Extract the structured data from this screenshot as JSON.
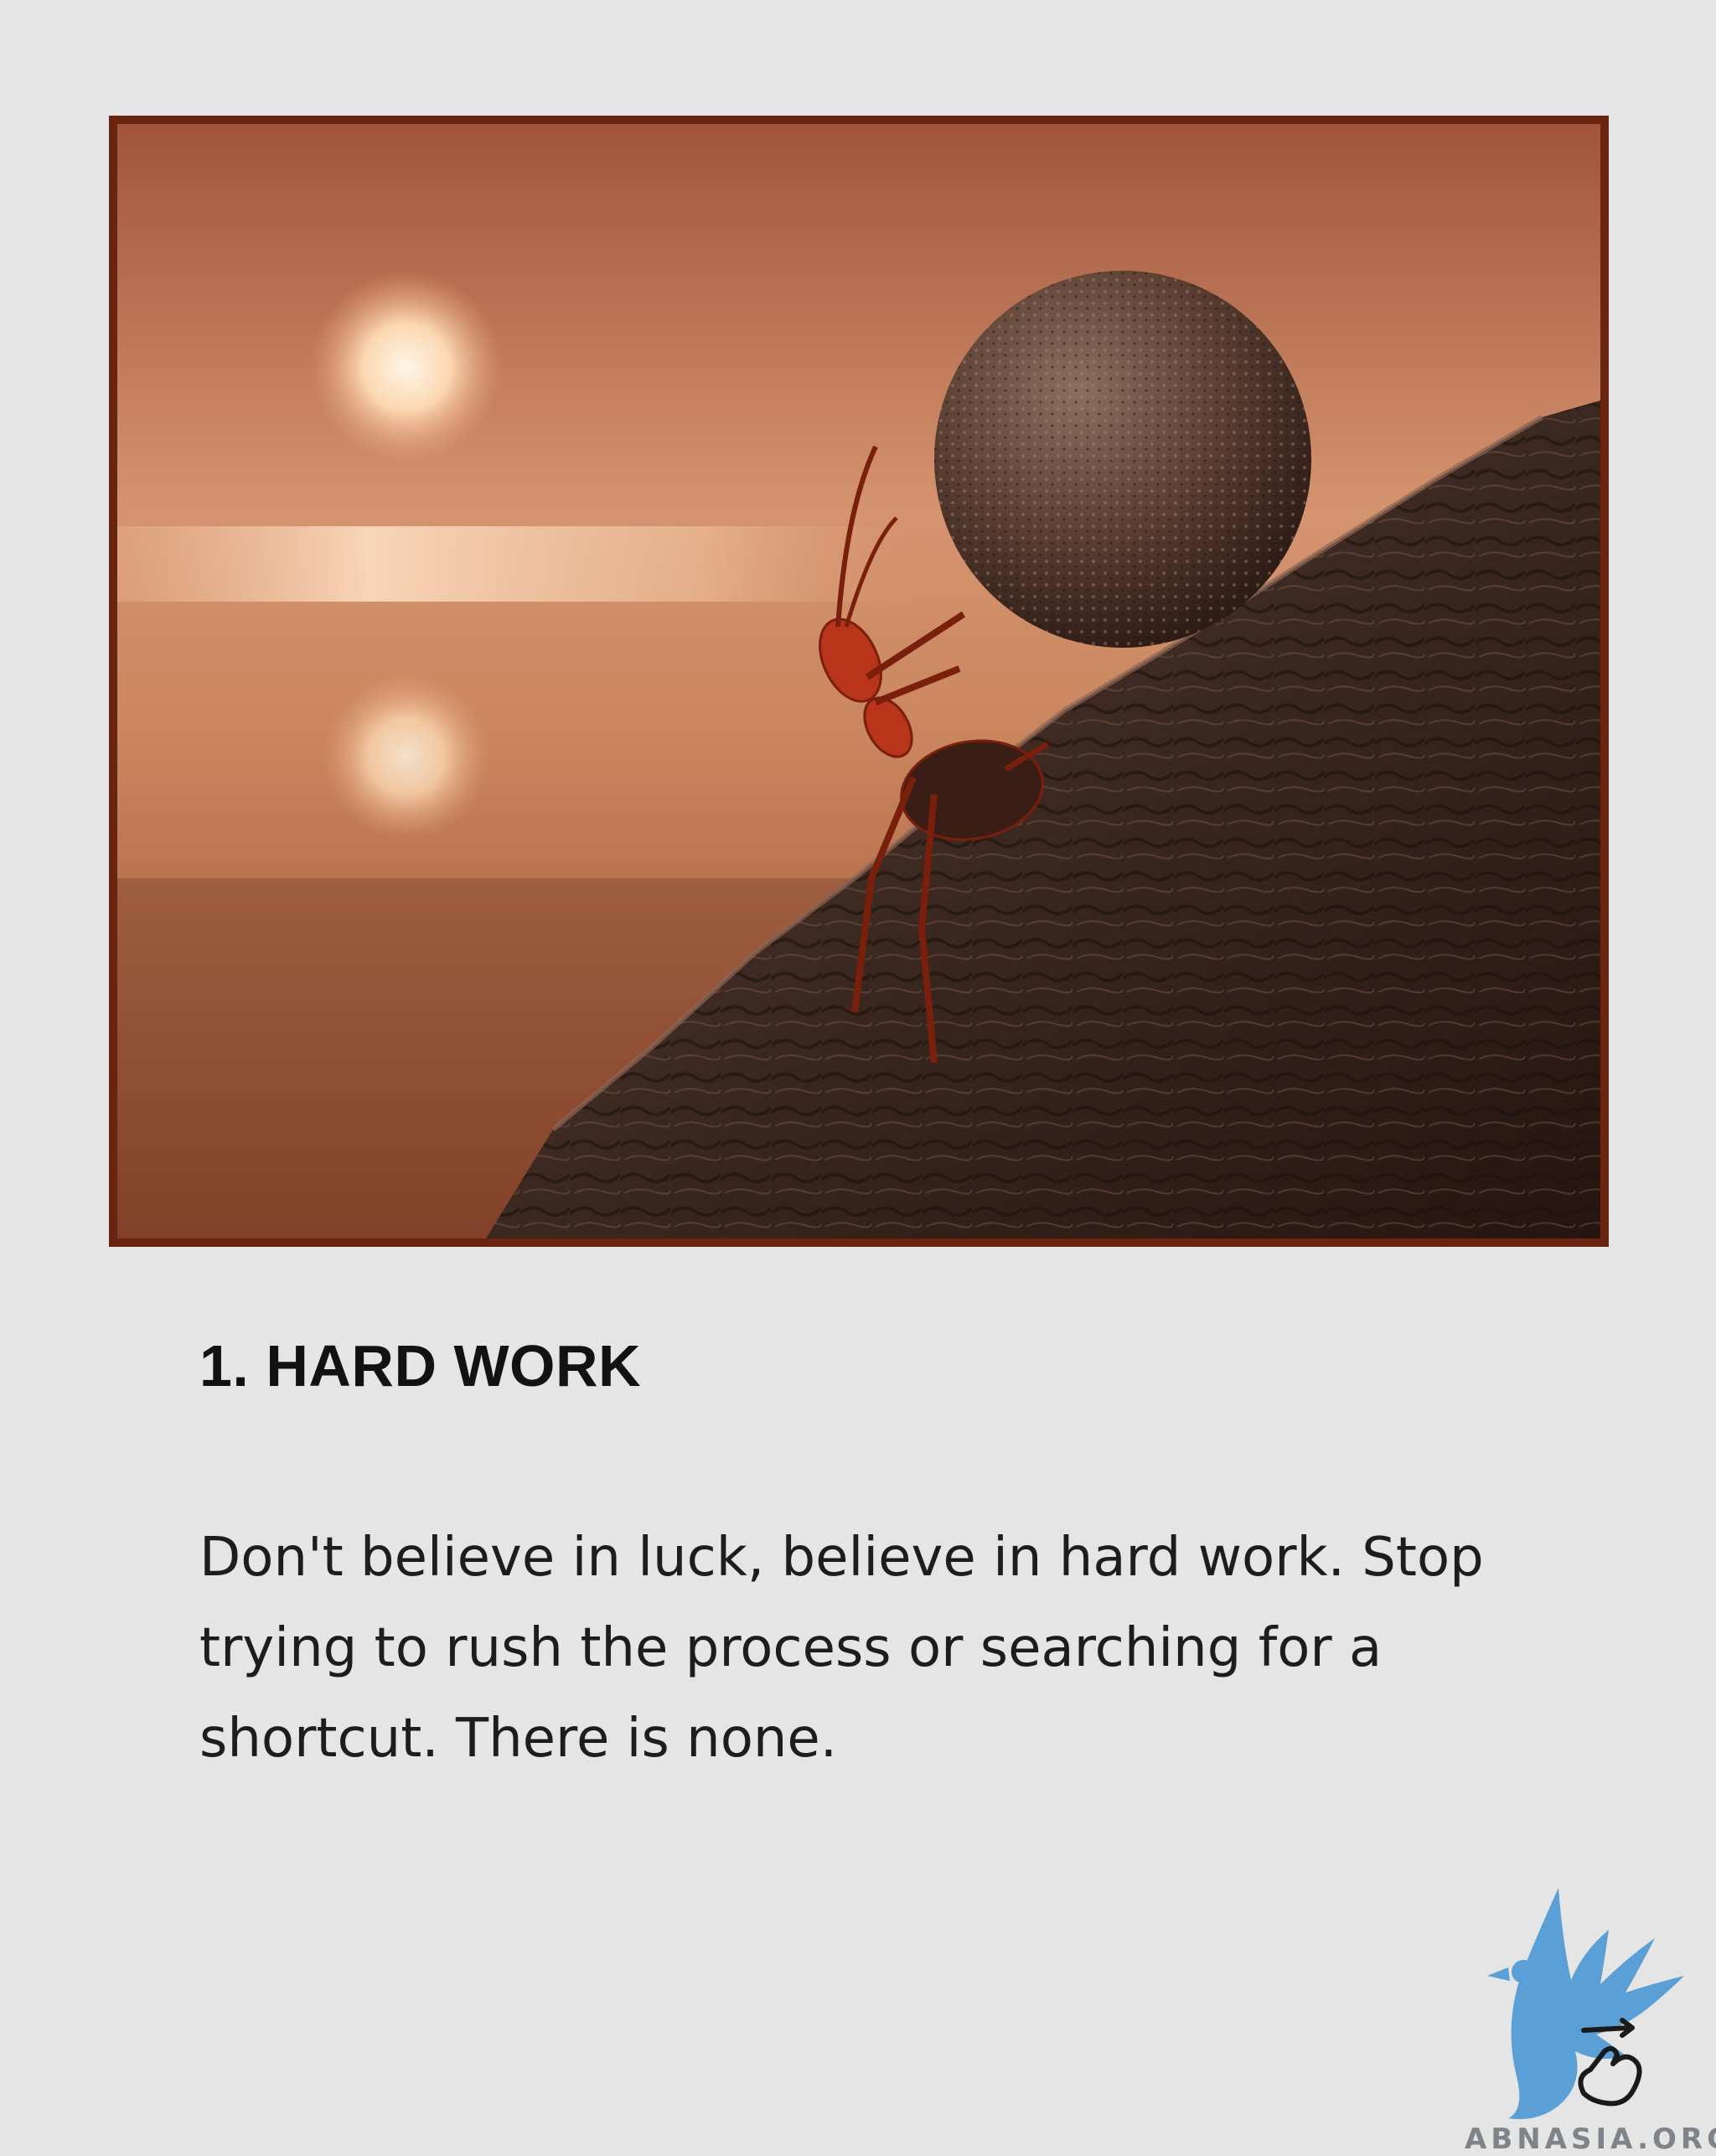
{
  "post": {
    "heading": "1. HARD WORK",
    "body": "Don't believe in luck, believe in hard work. Stop trying to rush the process or searching for a shortcut. There is none."
  },
  "watermark": {
    "text": "ABNASIA.ORG",
    "icon": "bird-with-swipe-hand-icon"
  },
  "colors": {
    "background": "#e4e5e4",
    "frame": "#6a2510",
    "sky": "#c9865e",
    "rock": "#3e2a22",
    "ant": "#b8341a",
    "logo_blue": "#5a9fd6"
  }
}
